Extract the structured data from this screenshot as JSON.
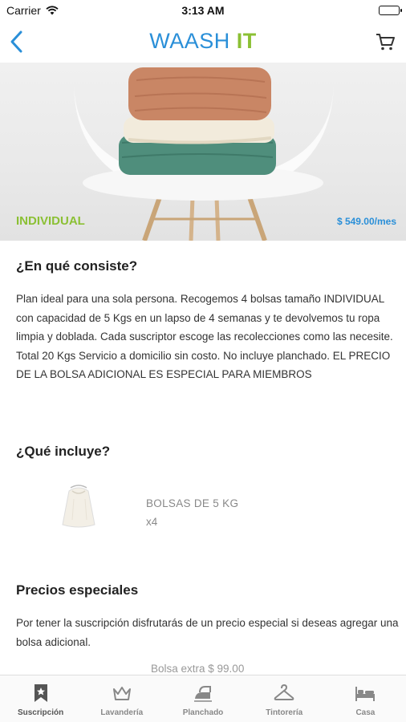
{
  "status": {
    "carrier": "Carrier",
    "time": "3:13 AM"
  },
  "nav": {
    "brand_part1": "WAASH ",
    "brand_part2": "IT",
    "brand_color_primary": "#2a8fd8",
    "brand_color_accent": "#8bc034"
  },
  "hero": {
    "plan_name": "INDIVIDUAL",
    "price": "$ 549.00/mes"
  },
  "sections": {
    "consiste": {
      "title": "¿En qué consiste?",
      "body": "Plan ideal para una sola persona. Recogemos 4 bolsas tamaño INDIVIDUAL con capacidad de 5 Kgs en un lapso de 4 semanas y te devolvemos tu ropa limpia y doblada. Cada suscriptor escoge las recolecciones como las necesite. Total 20 Kgs Servicio a domicilio sin costo. No incluye planchado. EL PRECIO DE LA BOLSA ADICIONAL ES ESPECIAL PARA MIEMBROS"
    },
    "incluye": {
      "title": "¿Qué incluye?",
      "items": [
        {
          "name": "BOLSAS DE 5 KG",
          "qty": "x4",
          "icon": "laundry-bag-image"
        }
      ]
    },
    "precios": {
      "title": "Precios especiales",
      "body": "Por tener la suscripción disfrutarás de un precio especial si deseas agregar una bolsa adicional.",
      "extra": "Bolsa extra $ 99.00"
    }
  },
  "tabs": [
    {
      "label": "Suscripción",
      "icon": "bookmark-star-icon",
      "active": true
    },
    {
      "label": "Lavandería",
      "icon": "crown-icon",
      "active": false
    },
    {
      "label": "Planchado",
      "icon": "iron-icon",
      "active": false
    },
    {
      "label": "Tintorería",
      "icon": "hanger-icon",
      "active": false
    },
    {
      "label": "Casa",
      "icon": "bed-icon",
      "active": false
    }
  ]
}
